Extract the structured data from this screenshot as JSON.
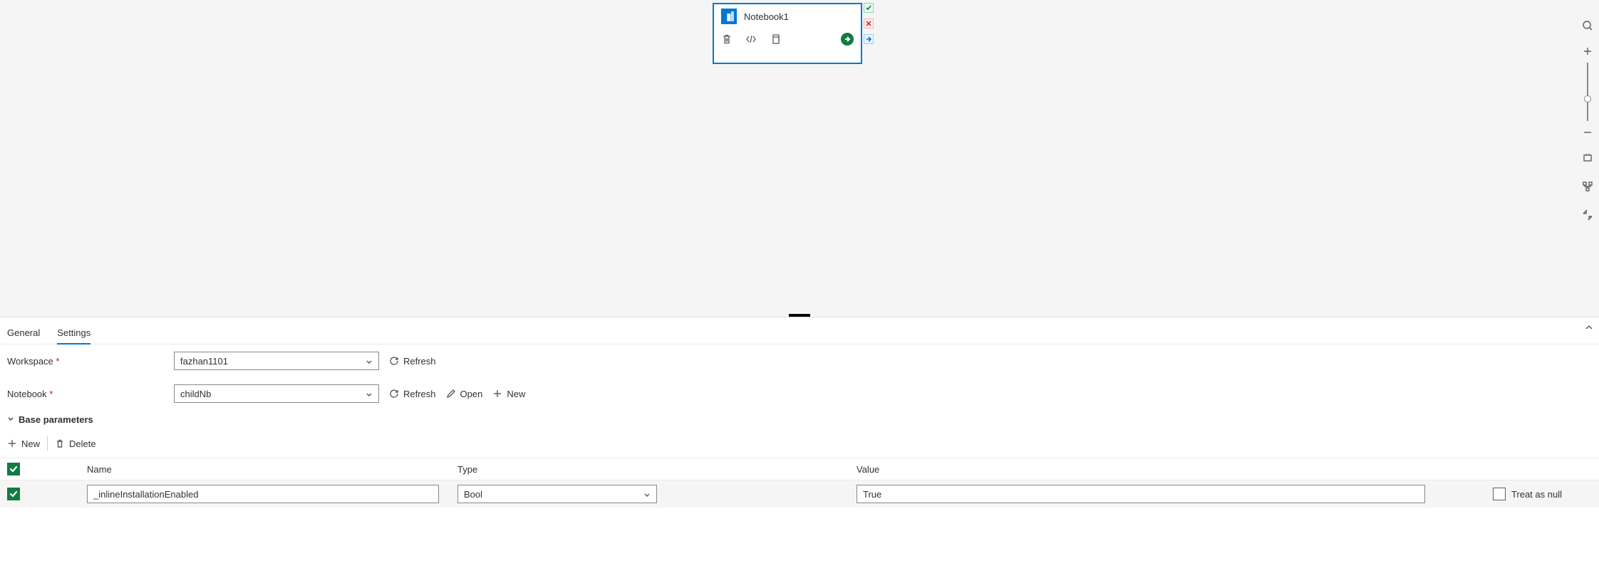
{
  "activity": {
    "title": "Notebook1",
    "icons": {
      "trash": "trash-icon",
      "code": "code-icon",
      "copy": "copy-icon",
      "go": "go-arrow-icon"
    }
  },
  "tabs": {
    "general": "General",
    "settings": "Settings"
  },
  "form": {
    "workspace_label": "Workspace",
    "workspace_value": "fazhan1101",
    "workspace_refresh": "Refresh",
    "notebook_label": "Notebook",
    "notebook_value": "childNb",
    "notebook_refresh": "Refresh",
    "notebook_open": "Open",
    "notebook_new": "New"
  },
  "section": {
    "base_params": "Base parameters"
  },
  "toolbar": {
    "new_label": "New",
    "delete_label": "Delete"
  },
  "table": {
    "headers": {
      "name": "Name",
      "type": "Type",
      "value": "Value"
    },
    "treat_as_null": "Treat as null",
    "rows": [
      {
        "name": "_inlineInstallationEnabled",
        "type": "Bool",
        "value": "True",
        "checked": true,
        "treat_null": false
      }
    ],
    "header_checked": true
  }
}
